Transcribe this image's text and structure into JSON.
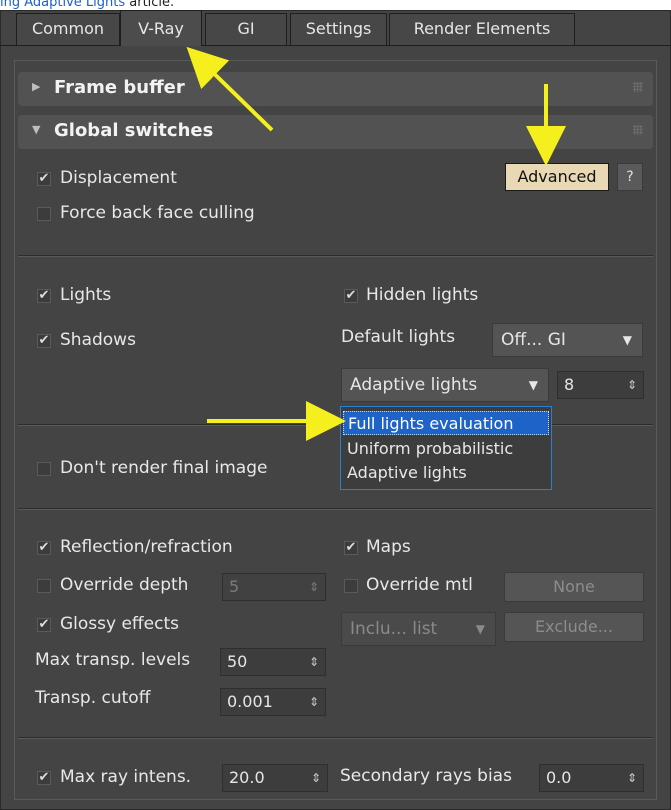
{
  "caption": {
    "link": "ing Adaptive Lights",
    "tail": " article."
  },
  "tabs": [
    {
      "label": "Common"
    },
    {
      "label": "V-Ray"
    },
    {
      "label": "GI"
    },
    {
      "label": "Settings"
    },
    {
      "label": "Render Elements"
    }
  ],
  "rollouts": {
    "frame_buffer": "Frame buffer",
    "global_switches": "Global switches"
  },
  "global": {
    "displacement": "Displacement",
    "force_back_face_culling": "Force back face culling",
    "advanced_button": "Advanced",
    "help_button": "?",
    "lights": "Lights",
    "hidden_lights": "Hidden lights",
    "shadows": "Shadows",
    "default_lights_label": "Default lights",
    "default_lights_value": "Off... GI",
    "light_mode_value": "Adaptive lights",
    "light_count": "8",
    "dont_render_final": "Don't render final image",
    "reflection_refraction": "Reflection/refraction",
    "maps": "Maps",
    "override_depth": "Override depth",
    "override_depth_value": "5",
    "override_mtl": "Override mtl",
    "none_button": "None",
    "glossy_effects": "Glossy effects",
    "include_list": "Inclu... list",
    "exclude_button": "Exclude...",
    "max_transp_label": "Max transp. levels",
    "max_transp_value": "50",
    "transp_cutoff_label": "Transp. cutoff",
    "transp_cutoff_value": "0.001",
    "max_ray_intens": "Max ray intens.",
    "max_ray_intens_value": "20.0",
    "secondary_bias_label": "Secondary rays bias",
    "secondary_bias_value": "0.0"
  },
  "light_mode_options": [
    "Full lights evaluation",
    "Uniform probabilistic",
    "Adaptive lights"
  ],
  "glyphs": {
    "check": "✔",
    "collapsed": "▶",
    "expanded": "▼",
    "dropdown": "▼",
    "spinner": "⇕"
  },
  "colors": {
    "annotation_arrow": "#f5ef1e",
    "selection": "#1e64c8",
    "advanced_highlight": "#e8d9b4"
  }
}
